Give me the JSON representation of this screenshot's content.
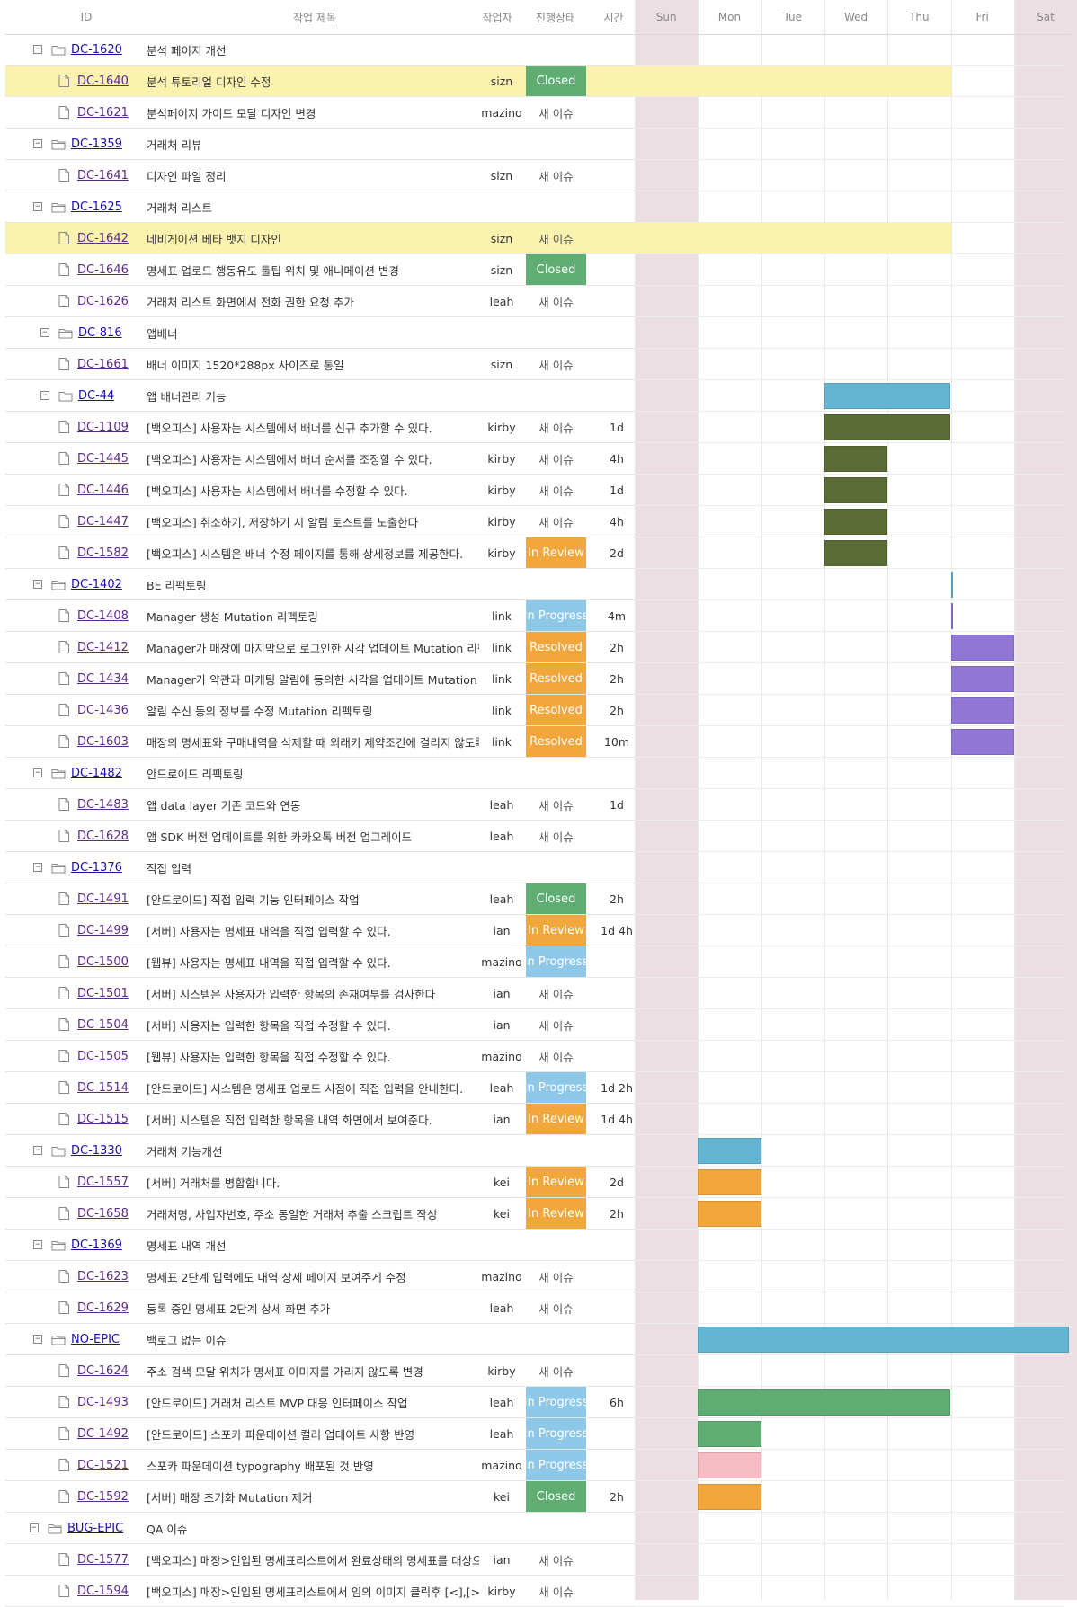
{
  "columns": {
    "id": "ID",
    "title": "작업 제목",
    "assignee": "작업자",
    "status": "진행상태",
    "time": "시간"
  },
  "days": [
    "Sun",
    "Mon",
    "Tue",
    "Wed",
    "Thu",
    "Fri",
    "Sat"
  ],
  "colors": {
    "Closed": "#5fad72",
    "In Review": "#f1a73b",
    "Resolved": "#f1a73b",
    "In Progress": "#8ec8e8",
    "bar_epic": "#63b6d2",
    "bar_olive": "#5a6b35",
    "bar_purple": "#9076d6",
    "bar_orange": "#f1a73b",
    "bar_green": "#5fad72",
    "bar_pink": "#f5bcc5",
    "weekend": "#ecdfe3",
    "highlight": "#fbf2b0"
  },
  "rows": [
    {
      "type": "epic",
      "id": "DC-1620",
      "title": "분석 페이지 개선",
      "assignee": "",
      "status": "",
      "time": "",
      "icon": "folder-open-icon"
    },
    {
      "type": "task",
      "id": "DC-1640",
      "title": "분석 튜토리얼 디자인 수정",
      "assignee": "sizn",
      "status": "Closed",
      "time": "",
      "highlight": true,
      "icon": "file-icon"
    },
    {
      "type": "task",
      "id": "DC-1621",
      "title": "분석페이지 가이드 모달 디자인 변경",
      "assignee": "mazino",
      "status": "새 이슈",
      "time": "",
      "icon": "file-icon"
    },
    {
      "type": "epic",
      "id": "DC-1359",
      "title": "거래처 리뷰",
      "assignee": "",
      "status": "",
      "time": "",
      "icon": "folder-open-icon"
    },
    {
      "type": "task",
      "id": "DC-1641",
      "title": "디자인 파일 정리",
      "assignee": "sizn",
      "status": "새 이슈",
      "time": "",
      "icon": "file-icon"
    },
    {
      "type": "epic",
      "id": "DC-1625",
      "title": "거래처 리스트",
      "assignee": "",
      "status": "",
      "time": "",
      "icon": "folder-open-icon"
    },
    {
      "type": "task",
      "id": "DC-1642",
      "title": "네비게이션 베타 뱃지 디자인",
      "assignee": "sizn",
      "status": "새 이슈",
      "time": "",
      "highlight": true,
      "icon": "file-icon"
    },
    {
      "type": "task",
      "id": "DC-1646",
      "title": "명세표 업로드 행동유도 툴팁 위치 및 애니메이션 변경",
      "assignee": "sizn",
      "status": "Closed",
      "time": "",
      "icon": "file-icon"
    },
    {
      "type": "task",
      "id": "DC-1626",
      "title": "거래처 리스트 화면에서 전화 권한 요청 추가",
      "assignee": "leah",
      "status": "새 이슈",
      "time": "",
      "icon": "file-icon"
    },
    {
      "type": "epic",
      "id": "DC-816",
      "title": "앱배너",
      "assignee": "",
      "status": "",
      "time": "",
      "icon": "folder-open-icon",
      "indent": 8
    },
    {
      "type": "task",
      "id": "DC-1661",
      "title": "배너 이미지 1520*288px 사이즈로 통일",
      "assignee": "sizn",
      "status": "새 이슈",
      "time": "",
      "icon": "file-icon"
    },
    {
      "type": "epic",
      "id": "DC-44",
      "title": "앱 배너관리 기능",
      "assignee": "",
      "status": "",
      "time": "",
      "icon": "folder-open-icon",
      "indent": 8,
      "bar": {
        "start": 3,
        "span": 2,
        "color": "bar_epic"
      }
    },
    {
      "type": "task",
      "id": "DC-1109",
      "title": "[백오피스] 사용자는 시스템에서 배너를 신규 추가할 수 있다.",
      "assignee": "kirby",
      "status": "새 이슈",
      "time": "1d",
      "icon": "file-icon",
      "bar": {
        "start": 3,
        "span": 2,
        "color": "bar_olive"
      }
    },
    {
      "type": "task",
      "id": "DC-1445",
      "title": "[백오피스] 사용자는 시스템에서 배너 순서를 조정할 수 있다.",
      "assignee": "kirby",
      "status": "새 이슈",
      "time": "4h",
      "icon": "file-icon",
      "bar": {
        "start": 3,
        "span": 1,
        "color": "bar_olive"
      }
    },
    {
      "type": "task",
      "id": "DC-1446",
      "title": "[백오피스] 사용자는 시스템에서 배너를 수정할 수 있다.",
      "assignee": "kirby",
      "status": "새 이슈",
      "time": "1d",
      "icon": "file-icon",
      "bar": {
        "start": 3,
        "span": 1,
        "color": "bar_olive"
      }
    },
    {
      "type": "task",
      "id": "DC-1447",
      "title": "[백오피스] 취소하기, 저장하기 시 알림 토스트를 노출한다",
      "assignee": "kirby",
      "status": "새 이슈",
      "time": "4h",
      "icon": "file-icon",
      "bar": {
        "start": 3,
        "span": 1,
        "color": "bar_olive"
      }
    },
    {
      "type": "task",
      "id": "DC-1582",
      "title": "[백오피스] 시스템은 배너 수정 페이지를 통해 상세정보를 제공한다.",
      "assignee": "kirby",
      "status": "In Review",
      "time": "2d",
      "icon": "file-icon",
      "bar": {
        "start": 3,
        "span": 1,
        "color": "bar_olive"
      }
    },
    {
      "type": "epic",
      "id": "DC-1402",
      "title": "BE 리펙토링",
      "assignee": "",
      "status": "",
      "time": "",
      "icon": "folder-open-icon",
      "bar": {
        "start": 5,
        "span": 0.03,
        "color": "bar_epic"
      }
    },
    {
      "type": "task",
      "id": "DC-1408",
      "title": "Manager 생성 Mutation 리펙토링",
      "assignee": "link",
      "status": "In Progress",
      "time": "4m",
      "icon": "file-icon",
      "bar": {
        "start": 5,
        "span": 0.03,
        "color": "bar_purple"
      }
    },
    {
      "type": "task",
      "id": "DC-1412",
      "title": "Manager가 매장에 마지막으로 로그인한 시각 업데이트 Mutation 리펙토링",
      "assignee": "link",
      "status": "Resolved",
      "time": "2h",
      "icon": "file-icon",
      "bar": {
        "start": 5,
        "span": 1,
        "color": "bar_purple"
      }
    },
    {
      "type": "task",
      "id": "DC-1434",
      "title": "Manager가 약관과 마케팅 알림에 동의한 시각을 업데이트 Mutation 리펙토링",
      "assignee": "link",
      "status": "Resolved",
      "time": "2h",
      "icon": "file-icon",
      "bar": {
        "start": 5,
        "span": 1,
        "color": "bar_purple"
      }
    },
    {
      "type": "task",
      "id": "DC-1436",
      "title": "알림 수신 동의 정보를 수정 Mutation 리펙토링",
      "assignee": "link",
      "status": "Resolved",
      "time": "2h",
      "icon": "file-icon",
      "bar": {
        "start": 5,
        "span": 1,
        "color": "bar_purple"
      }
    },
    {
      "type": "task",
      "id": "DC-1603",
      "title": "매장의 명세표와 구매내역을 삭제할 때 외래키 제약조건에 걸리지 않도록 수정",
      "assignee": "link",
      "status": "Resolved",
      "time": "10m",
      "icon": "file-icon",
      "bar": {
        "start": 5,
        "span": 1,
        "color": "bar_purple"
      }
    },
    {
      "type": "epic",
      "id": "DC-1482",
      "title": "안드로이드 리펙토링",
      "assignee": "",
      "status": "",
      "time": "",
      "icon": "folder-open-icon"
    },
    {
      "type": "task",
      "id": "DC-1483",
      "title": "앱 data layer 기존 코드와 연동",
      "assignee": "leah",
      "status": "새 이슈",
      "time": "1d",
      "icon": "file-icon"
    },
    {
      "type": "task",
      "id": "DC-1628",
      "title": "앱 SDK 버전 업데이트를 위한 카카오톡 버전 업그레이드",
      "assignee": "leah",
      "status": "새 이슈",
      "time": "",
      "icon": "file-icon"
    },
    {
      "type": "epic",
      "id": "DC-1376",
      "title": "직접 입력",
      "assignee": "",
      "status": "",
      "time": "",
      "icon": "folder-open-icon"
    },
    {
      "type": "task",
      "id": "DC-1491",
      "title": "[안드로이드] 직접 입력 기능 인터페이스 작업",
      "assignee": "leah",
      "status": "Closed",
      "time": "2h",
      "icon": "file-icon"
    },
    {
      "type": "task",
      "id": "DC-1499",
      "title": "[서버] 사용자는 명세표 내역을 직접 입력할 수 있다.",
      "assignee": "ian",
      "status": "In Review",
      "time": "1d 4h",
      "icon": "file-icon"
    },
    {
      "type": "task",
      "id": "DC-1500",
      "title": "[웹뷰] 사용자는 명세표 내역을 직접 입력할 수 있다.",
      "assignee": "mazino",
      "status": "In Progress",
      "time": "",
      "icon": "file-icon"
    },
    {
      "type": "task",
      "id": "DC-1501",
      "title": "[서버] 시스템은 사용자가 입력한 항목의 존재여부를 검사한다",
      "assignee": "ian",
      "status": "새 이슈",
      "time": "",
      "icon": "file-icon"
    },
    {
      "type": "task",
      "id": "DC-1504",
      "title": "[서버] 사용자는 입력한 항목을 직접 수정할 수 있다.",
      "assignee": "ian",
      "status": "새 이슈",
      "time": "",
      "icon": "file-icon"
    },
    {
      "type": "task",
      "id": "DC-1505",
      "title": "[웹뷰] 사용자는 입력한 항목을 직접 수정할 수 있다.",
      "assignee": "mazino",
      "status": "새 이슈",
      "time": "",
      "icon": "file-icon"
    },
    {
      "type": "task",
      "id": "DC-1514",
      "title": "[안드로이드] 시스템은 명세표 업로드 시점에 직접 입력을 안내한다.",
      "assignee": "leah",
      "status": "In Progress",
      "time": "1d 2h",
      "icon": "file-icon"
    },
    {
      "type": "task",
      "id": "DC-1515",
      "title": "[서버] 시스템은 직접 입력한 항목을 내역 화면에서 보여준다.",
      "assignee": "ian",
      "status": "In Review",
      "time": "1d 4h",
      "icon": "file-icon"
    },
    {
      "type": "epic",
      "id": "DC-1330",
      "title": "거래처 기능개선",
      "assignee": "",
      "status": "",
      "time": "",
      "icon": "folder-open-icon",
      "bar": {
        "start": 1,
        "span": 1,
        "color": "bar_epic"
      }
    },
    {
      "type": "task",
      "id": "DC-1557",
      "title": "[서버] 거래처를 병합합니다.",
      "assignee": "kei",
      "status": "In Review",
      "time": "2d",
      "icon": "file-icon",
      "bar": {
        "start": 1,
        "span": 1,
        "color": "bar_orange"
      }
    },
    {
      "type": "task",
      "id": "DC-1658",
      "title": "거래처명, 사업자번호, 주소 동일한 거래처 추출 스크립트 작성",
      "assignee": "kei",
      "status": "In Review",
      "time": "2h",
      "icon": "file-icon",
      "bar": {
        "start": 1,
        "span": 1,
        "color": "bar_orange"
      }
    },
    {
      "type": "epic",
      "id": "DC-1369",
      "title": "명세표 내역 개선",
      "assignee": "",
      "status": "",
      "time": "",
      "icon": "folder-open-icon"
    },
    {
      "type": "task",
      "id": "DC-1623",
      "title": "명세표 2단계 입력에도 내역 상세 페이지 보여주게 수정",
      "assignee": "mazino",
      "status": "새 이슈",
      "time": "",
      "icon": "file-icon"
    },
    {
      "type": "task",
      "id": "DC-1629",
      "title": "등록 중인 명세표 2단계 상세 화면 추가",
      "assignee": "leah",
      "status": "새 이슈",
      "time": "",
      "icon": "file-icon"
    },
    {
      "type": "epic",
      "id": "NO-EPIC",
      "title": "백로그 없는 이슈",
      "assignee": "",
      "status": "",
      "time": "",
      "icon": "folder-open-icon",
      "bar": {
        "start": 1,
        "span": 5.87,
        "color": "bar_epic"
      }
    },
    {
      "type": "task",
      "id": "DC-1624",
      "title": "주소 검색 모달 위치가 명세표 이미지를 가리지 않도록 변경",
      "assignee": "kirby",
      "status": "새 이슈",
      "time": "",
      "icon": "file-icon"
    },
    {
      "type": "task",
      "id": "DC-1493",
      "title": "[안드로이드] 거래처 리스트 MVP 대응 인터페이스 작업",
      "assignee": "leah",
      "status": "In Progress",
      "time": "6h",
      "icon": "file-icon",
      "bar": {
        "start": 1,
        "span": 4,
        "color": "bar_green"
      }
    },
    {
      "type": "task",
      "id": "DC-1492",
      "title": "[안드로이드] 스포카 파운데이션 컬러 업데이트 사항 반영",
      "assignee": "leah",
      "status": "In Progress",
      "time": "",
      "icon": "file-icon",
      "bar": {
        "start": 1,
        "span": 1,
        "color": "bar_green"
      }
    },
    {
      "type": "task",
      "id": "DC-1521",
      "title": "스포카 파운데이션 typography 배포된 것 반영",
      "assignee": "mazino",
      "status": "In Progress",
      "time": "",
      "icon": "file-icon",
      "bar": {
        "start": 1,
        "span": 1,
        "color": "bar_pink"
      }
    },
    {
      "type": "task",
      "id": "DC-1592",
      "title": "[서버] 매장 초기화 Mutation 제거",
      "assignee": "kei",
      "status": "Closed",
      "time": "2h",
      "icon": "file-icon",
      "bar": {
        "start": 1,
        "span": 1,
        "color": "bar_orange"
      }
    },
    {
      "type": "epic",
      "id": "BUG-EPIC",
      "title": "QA 이슈",
      "assignee": "",
      "status": "",
      "time": "",
      "icon": "folder-open-icon",
      "indent": -4
    },
    {
      "type": "task",
      "id": "DC-1577",
      "title": "[백오피스] 매장>인입된 명세표리스트에서 완료상태의 명세표를 대상으로",
      "assignee": "ian",
      "status": "새 이슈",
      "time": "",
      "icon": "file-icon"
    },
    {
      "type": "task",
      "id": "DC-1594",
      "title": "[백오피스] 매장>인입된 명세표리스트에서 임의 이미지 클릭후 [<],[>]로",
      "assignee": "kirby",
      "status": "새 이슈",
      "time": "",
      "icon": "file-icon"
    }
  ]
}
